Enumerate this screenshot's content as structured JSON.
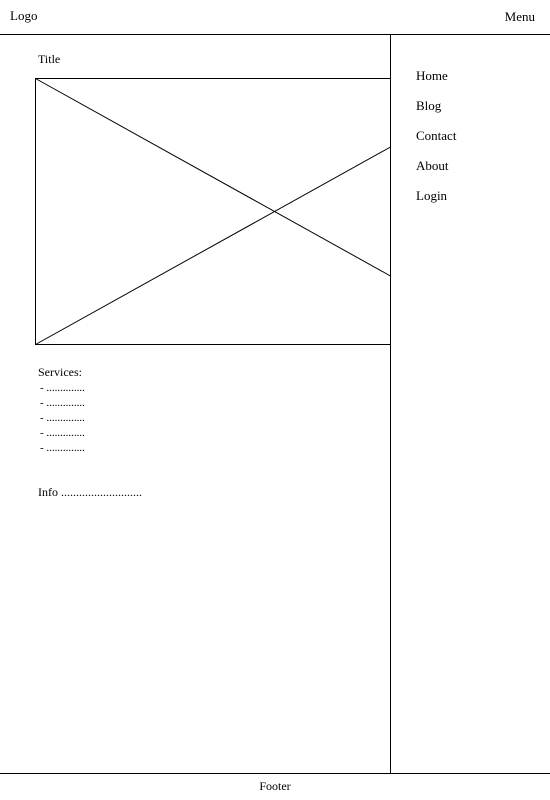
{
  "header": {
    "logo": "Logo",
    "menu_label": "Menu"
  },
  "main": {
    "title": "Title",
    "services_heading": "Services:",
    "services_items": [
      "- ..............",
      "- ..............",
      "- ..............",
      "- ..............",
      "- .............."
    ],
    "info": "Info ..........................."
  },
  "nav": {
    "items": [
      {
        "label": "Home"
      },
      {
        "label": "Blog"
      },
      {
        "label": "Contact"
      },
      {
        "label": "About"
      },
      {
        "label": "Login"
      }
    ]
  },
  "footer": {
    "text": "Footer"
  }
}
